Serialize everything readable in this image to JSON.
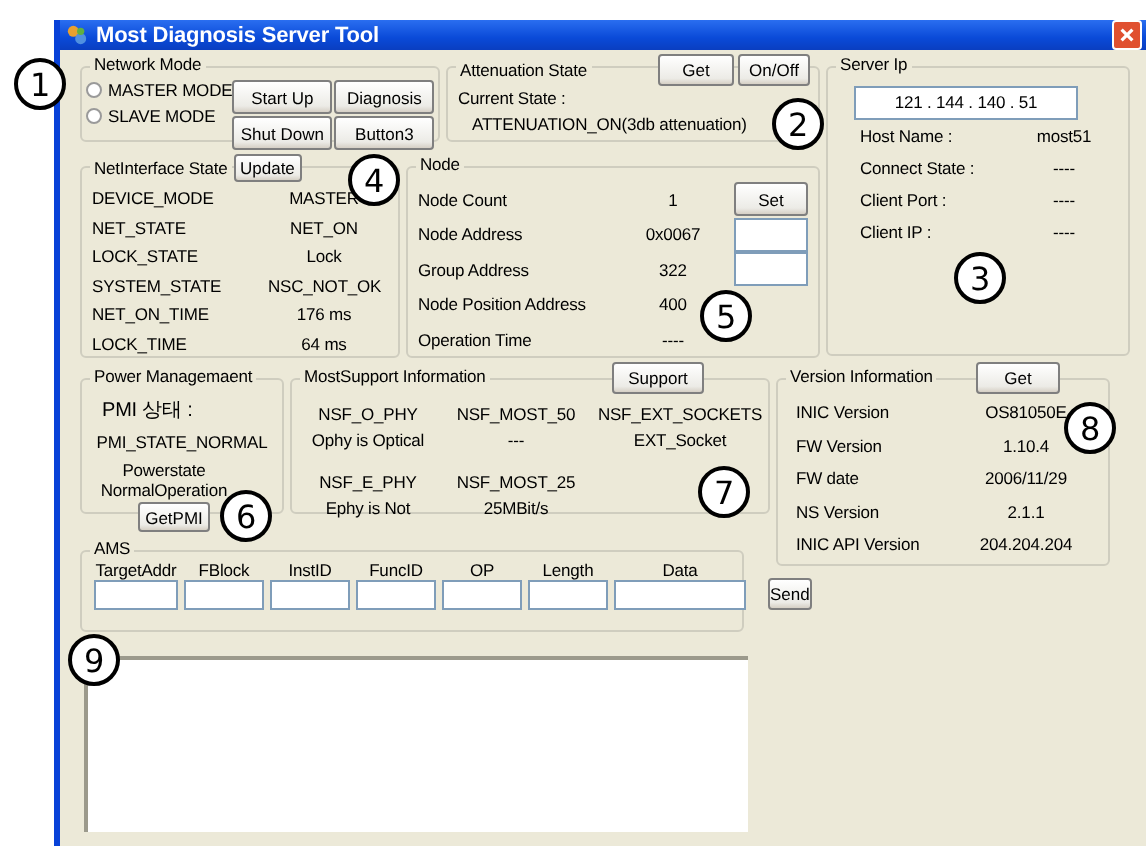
{
  "window": {
    "title": "Most Diagnosis Server Tool"
  },
  "network_mode": {
    "label": "Network Mode",
    "modes": [
      {
        "label": "MASTER MODE",
        "selected": false
      },
      {
        "label": "SLAVE MODE",
        "selected": false
      }
    ],
    "buttons": [
      "Start Up",
      "Diagnosis",
      "Shut Down",
      "Button3"
    ]
  },
  "attenuation": {
    "label": "Attenuation State",
    "buttons": [
      "Get",
      "On/Off"
    ],
    "current_label": "Current State :",
    "current_value": "ATTENUATION_ON(3db attenuation)"
  },
  "server_ip": {
    "label": "Server Ip",
    "address": "121 . 144 . 140 . 51",
    "fields": [
      {
        "label": "Host Name :",
        "value": "most51"
      },
      {
        "label": "Connect State :",
        "value": "----"
      },
      {
        "label": "Client Port :",
        "value": "----"
      },
      {
        "label": "Client IP :",
        "value": "----"
      }
    ]
  },
  "net_interface": {
    "label": "NetInterface State",
    "button": "Update",
    "rows": [
      {
        "name": "DEVICE_MODE",
        "value": "MASTER"
      },
      {
        "name": "NET_STATE",
        "value": "NET_ON"
      },
      {
        "name": "LOCK_STATE",
        "value": "Lock"
      },
      {
        "name": "SYSTEM_STATE",
        "value": "NSC_NOT_OK"
      },
      {
        "name": "NET_ON_TIME",
        "value": "176 ms"
      },
      {
        "name": "LOCK_TIME",
        "value": "64 ms"
      }
    ]
  },
  "node": {
    "label": "Node",
    "rows": [
      {
        "label": "Node Count",
        "value": "1",
        "kind": "button",
        "button": "Set"
      },
      {
        "label": "Node Address",
        "value": "0x0067",
        "kind": "input"
      },
      {
        "label": "Group Address",
        "value": "322",
        "kind": "input"
      },
      {
        "label": "Node Position Address",
        "value": "400",
        "kind": "plain"
      },
      {
        "label": "Operation Time",
        "value": "----",
        "kind": "plain"
      }
    ]
  },
  "power": {
    "label": "Power Managemaent",
    "pmi_label": "PMI 상태 :",
    "pmi_state": "PMI_STATE_NORMAL",
    "powerstate": [
      "Powerstate",
      "NormalOperation"
    ],
    "button": "GetPMI"
  },
  "most_support": {
    "label": "MostSupport Information",
    "button": "Support",
    "rows": [
      [
        "NSF_O_PHY",
        "NSF_MOST_50",
        "NSF_EXT_SOCKETS"
      ],
      [
        "Ophy is Optical",
        "---",
        "EXT_Socket"
      ],
      [
        "NSF_E_PHY",
        "NSF_MOST_25"
      ],
      [
        "Ephy is Not",
        "25MBit/s"
      ]
    ]
  },
  "version": {
    "label": "Version Information",
    "button": "Get",
    "rows": [
      {
        "label": "INIC Version",
        "value": "OS81050E"
      },
      {
        "label": "FW Version",
        "value": "1.10.4"
      },
      {
        "label": "FW date",
        "value": "2006/11/29"
      },
      {
        "label": "NS Version",
        "value": "2.1.1"
      },
      {
        "label": "INIC API Version",
        "value": "204.204.204"
      }
    ]
  },
  "ams": {
    "label": "AMS",
    "fields": [
      "TargetAddr",
      "FBlock",
      "InstID",
      "FuncID",
      "OP",
      "Length",
      "Data"
    ],
    "button": "Send"
  },
  "callouts": [
    "1",
    "2",
    "3",
    "4",
    "5",
    "6",
    "7",
    "8",
    "9"
  ]
}
